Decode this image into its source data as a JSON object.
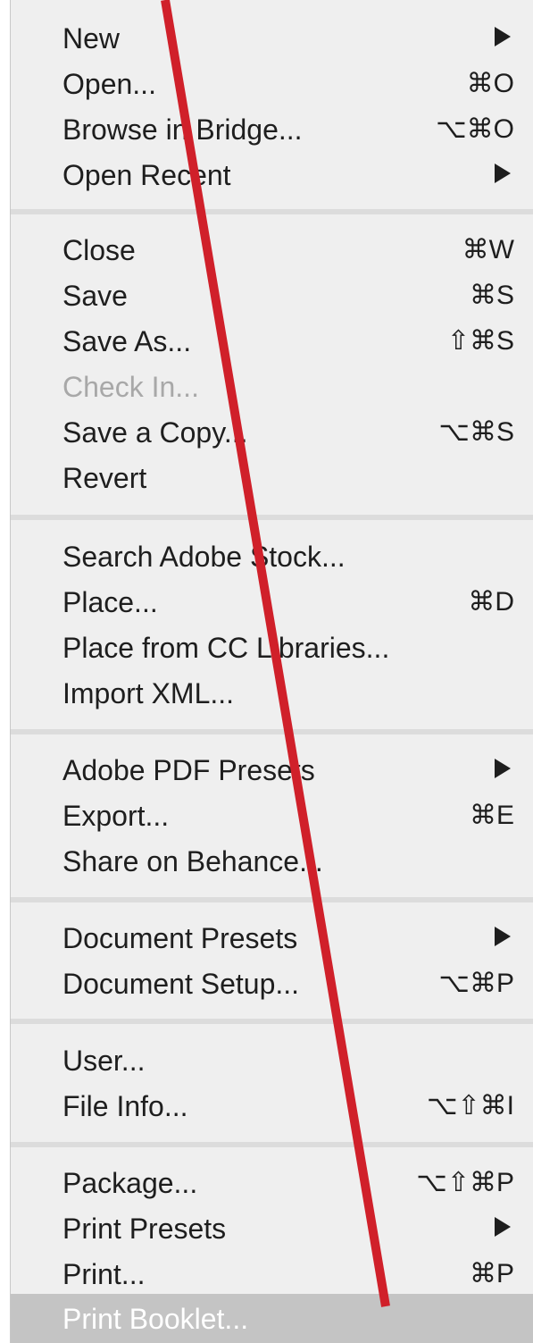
{
  "menu": {
    "items": [
      {
        "label": "New",
        "shortcut": "",
        "submenu": true
      },
      {
        "label": "Open...",
        "shortcut": "⌘O",
        "submenu": false
      },
      {
        "label": "Browse in Bridge...",
        "shortcut": "⌥⌘O",
        "submenu": false
      },
      {
        "label": "Open Recent",
        "shortcut": "",
        "submenu": true
      },
      {
        "label": "Close",
        "shortcut": "⌘W",
        "submenu": false
      },
      {
        "label": "Save",
        "shortcut": "⌘S",
        "submenu": false
      },
      {
        "label": "Save As...",
        "shortcut": "⇧⌘S",
        "submenu": false
      },
      {
        "label": "Check In...",
        "shortcut": "",
        "submenu": false,
        "disabled": true
      },
      {
        "label": "Save a Copy...",
        "shortcut": "⌥⌘S",
        "submenu": false
      },
      {
        "label": "Revert",
        "shortcut": "",
        "submenu": false
      },
      {
        "label": "Search Adobe Stock...",
        "shortcut": "",
        "submenu": false
      },
      {
        "label": "Place...",
        "shortcut": "⌘D",
        "submenu": false
      },
      {
        "label": "Place from CC Libraries...",
        "shortcut": "",
        "submenu": false
      },
      {
        "label": "Import XML...",
        "shortcut": "",
        "submenu": false
      },
      {
        "label": "Adobe PDF Presets",
        "shortcut": "",
        "submenu": true
      },
      {
        "label": "Export...",
        "shortcut": "⌘E",
        "submenu": false
      },
      {
        "label": "Share on Behance...",
        "shortcut": "",
        "submenu": false
      },
      {
        "label": "Document Presets",
        "shortcut": "",
        "submenu": true
      },
      {
        "label": "Document Setup...",
        "shortcut": "⌥⌘P",
        "submenu": false
      },
      {
        "label": "User...",
        "shortcut": "",
        "submenu": false
      },
      {
        "label": "File Info...",
        "shortcut": "⌥⇧⌘I",
        "submenu": false
      },
      {
        "label": "Package...",
        "shortcut": "⌥⇧⌘P",
        "submenu": false
      },
      {
        "label": "Print Presets",
        "shortcut": "",
        "submenu": true
      },
      {
        "label": "Print...",
        "shortcut": "⌘P",
        "submenu": false
      },
      {
        "label": "Print Booklet...",
        "shortcut": "",
        "submenu": false,
        "highlighted": true
      }
    ]
  },
  "annotation": {
    "type": "red-line",
    "color": "#d0202a"
  },
  "colors": {
    "menu_background": "#efefef",
    "separator": "#dcdcdc",
    "highlight": "#c4c4c4",
    "disabled_text": "#a8a8a8"
  }
}
